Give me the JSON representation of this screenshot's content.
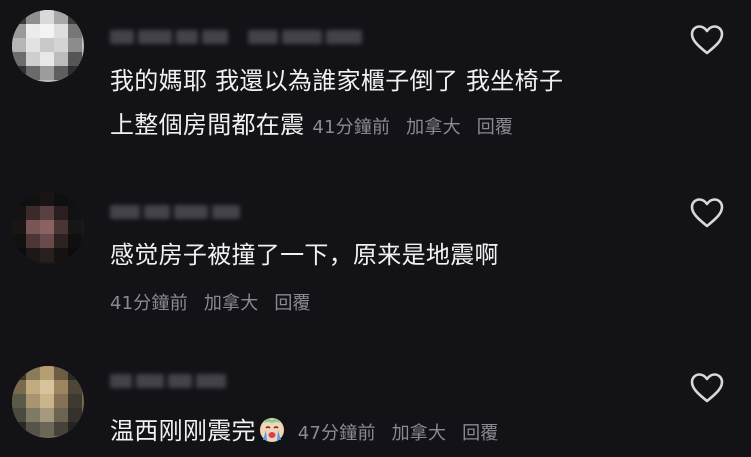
{
  "comments": [
    {
      "text_line1": "我的媽耶 我還以為誰家櫃子倒了 我坐椅子",
      "text_line2": "上整個房間都在震",
      "time": "41分鐘前",
      "location": "加拿大",
      "reply_label": "回覆"
    },
    {
      "text": "感觉房子被撞了一下，原来是地震啊",
      "time": "41分鐘前",
      "location": "加拿大",
      "reply_label": "回覆"
    },
    {
      "text": "温西刚刚震完",
      "emoji_icon": "crying-face-icon",
      "time": "47分鐘前",
      "location": "加拿大",
      "reply_label": "回覆"
    }
  ],
  "colors": {
    "background": "#121217",
    "text": "#f1f1f3",
    "meta": "#8a8a92",
    "heart_stroke": "#d8d8dc"
  }
}
